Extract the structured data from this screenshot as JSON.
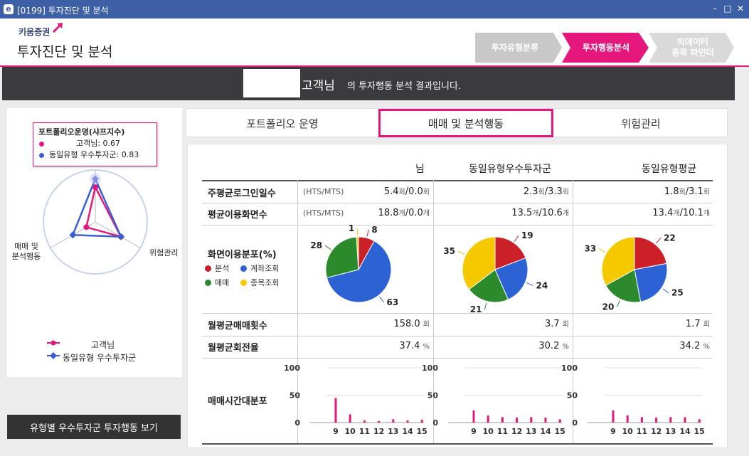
{
  "window": {
    "title": "[0199] 투자진단 및 분석"
  },
  "header": {
    "logo_text": "키움증권",
    "app_title": "투자진단 및 분석"
  },
  "steps": [
    {
      "label": "투자유형분류",
      "label2": "",
      "color": "#c8c8c8"
    },
    {
      "label": "투자행동분석",
      "label2": "",
      "color": "#e5177d"
    },
    {
      "label": "빅데이터",
      "label2": "종목 파인더",
      "color": "#d9d9d9"
    }
  ],
  "banner": {
    "customer": "고객님",
    "message": "의 투자행동 분석 결과입니다."
  },
  "radar": {
    "axes": [
      "포트폴리오운영(샤프지수)",
      "위험관리",
      "매매 및\n분석행동"
    ],
    "axis_right": "위험관리",
    "axis_left1": "매매 및",
    "axis_left2": "분석행동",
    "tooltip": {
      "title": "포트폴리오운영(샤프지수)",
      "line1": "고객님: 0.67",
      "line2": "동일유형 우수투자군: 0.83"
    },
    "series": [
      {
        "name": "고객님",
        "color": "#e5177d",
        "values": [
          0.67,
          0.57,
          0.2
        ]
      },
      {
        "name": "동일유형 우수투자군",
        "color": "#3a5fd0",
        "values": [
          0.83,
          0.57,
          0.5
        ]
      }
    ]
  },
  "view_button": "유형별 우수투자군 투자행동 보기",
  "tabs": [
    {
      "label": "포트폴리오 운영"
    },
    {
      "label": "매매 및 분석행동"
    },
    {
      "label": "위험관리"
    }
  ],
  "table": {
    "col_headers": [
      "님",
      "동일유형우수투자군",
      "동일유형평균"
    ],
    "hts_tag": "(HTS/MTS)",
    "rows": {
      "login": {
        "label": "주평균로그인일수",
        "c1a": "5.4",
        "c1b": "0.0",
        "c2a": "2.3",
        "c2b": "3.3",
        "c3a": "1.8",
        "c3b": "3.1",
        "unit": "회"
      },
      "screens": {
        "label": "평균이용화면수",
        "c1a": "18.8",
        "c1b": "0.0",
        "c2a": "13.5",
        "c2b": "10.6",
        "c3a": "13.4",
        "c3b": "10.1",
        "unit": "개"
      },
      "dist": {
        "label": "화면이용분포(%)"
      },
      "trades": {
        "label": "월평균매매횟수",
        "c1": "158.0",
        "c2": "3.7",
        "c3": "1.7",
        "unit": "회"
      },
      "turnover": {
        "label": "월평균회전율",
        "c1": "37.4",
        "c2": "30.2",
        "c3": "34.2",
        "unit": "%"
      },
      "timedist": {
        "label": "매매시간대분포"
      }
    }
  },
  "pie_legend": [
    {
      "name": "분석",
      "color": "#cc2028"
    },
    {
      "name": "계좌조회",
      "color": "#2d62d4"
    },
    {
      "name": "매매",
      "color": "#2a8a2c"
    },
    {
      "name": "종목조회",
      "color": "#f5c800"
    }
  ],
  "chart_data": [
    {
      "type": "pie",
      "categories": [
        "분석",
        "계좌조회",
        "매매",
        "종목조회"
      ],
      "values": [
        8,
        63,
        28,
        1
      ]
    },
    {
      "type": "pie",
      "categories": [
        "분석",
        "계좌조회",
        "매매",
        "종목조회"
      ],
      "values": [
        19,
        24,
        21,
        35
      ]
    },
    {
      "type": "pie",
      "categories": [
        "분석",
        "계좌조회",
        "매매",
        "종목조회"
      ],
      "values": [
        22,
        25,
        20,
        33
      ]
    },
    {
      "type": "bar",
      "categories": [
        "9",
        "10",
        "11",
        "12",
        "13",
        "14",
        "15"
      ],
      "values": [
        45,
        15,
        4,
        3,
        6,
        4,
        5
      ],
      "ylim": [
        0,
        100
      ],
      "yticks": [
        "100",
        "50",
        "0"
      ]
    },
    {
      "type": "bar",
      "categories": [
        "9",
        "10",
        "11",
        "12",
        "13",
        "14",
        "15"
      ],
      "values": [
        22,
        13,
        10,
        9,
        10,
        9,
        6
      ],
      "ylim": [
        0,
        100
      ],
      "yticks": [
        "100",
        "50",
        "0"
      ]
    },
    {
      "type": "bar",
      "categories": [
        "9",
        "10",
        "11",
        "12",
        "13",
        "14",
        "15"
      ],
      "values": [
        22,
        13,
        10,
        9,
        10,
        10,
        6
      ],
      "ylim": [
        0,
        100
      ],
      "yticks": [
        "100",
        "50",
        "0"
      ]
    }
  ]
}
